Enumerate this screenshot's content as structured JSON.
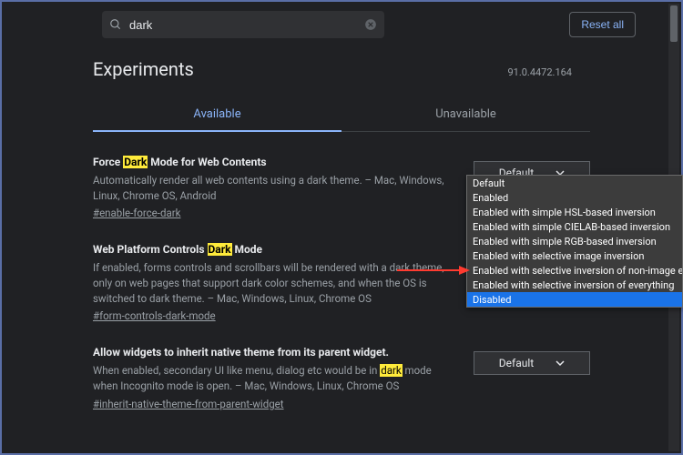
{
  "search": {
    "value": "dark"
  },
  "reset_label": "Reset all",
  "page_title": "Experiments",
  "version": "91.0.4472.164",
  "tabs": {
    "available": "Available",
    "unavailable": "Unavailable"
  },
  "flags": [
    {
      "title_pre": "Force ",
      "title_hl": "Dark",
      "title_post": " Mode for Web Contents",
      "desc": "Automatically render all web contents using a dark theme. – Mac, Windows, Linux, Chrome OS, Android",
      "hash": "#enable-force-dark",
      "select": "Default"
    },
    {
      "title_pre": "Web Platform Controls ",
      "title_hl": "Dark",
      "title_post": " Mode",
      "desc": "If enabled, forms controls and scrollbars will be rendered with a dark theme, only on web pages that support dark color schemes, and when the OS is switched to dark theme. – Mac, Windows, Linux, Chrome OS",
      "hash": "#form-controls-dark-mode",
      "select": ""
    },
    {
      "title_pre": "Allow widgets to inherit native theme from its parent widget.",
      "title_hl": "",
      "title_post": "",
      "desc_pre": "When enabled, secondary UI like menu, dialog etc would be in ",
      "desc_hl": "dark",
      "desc_post": " mode when Incognito mode is open. – Mac, Windows, Linux, Chrome OS",
      "hash": "#inherit-native-theme-from-parent-widget",
      "select": "Default"
    }
  ],
  "dropdown": {
    "items": [
      "Default",
      "Enabled",
      "Enabled with simple HSL-based inversion",
      "Enabled with simple CIELAB-based inversion",
      "Enabled with simple RGB-based inversion",
      "Enabled with selective image inversion",
      "Enabled with selective inversion of non-image elements",
      "Enabled with selective inversion of everything",
      "Disabled"
    ],
    "selected_index": 8
  }
}
